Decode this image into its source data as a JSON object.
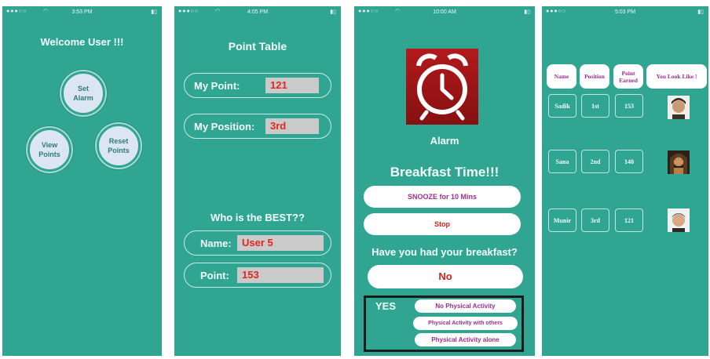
{
  "screens": {
    "welcome": {
      "status_time": "3:53 PM",
      "title": "Welcome User !!!",
      "set_alarm": "Set\nAlarm",
      "view_points": "View\nPoints",
      "reset_points": "Reset\nPoints"
    },
    "point_table": {
      "status_time": "4:05 PM",
      "title": "Point Table",
      "my_point_label": "My Point:",
      "my_point_value": "121",
      "my_position_label": "My Position:",
      "my_position_value": "3rd",
      "best_heading": "Who is the BEST??",
      "name_label": "Name:",
      "name_value": "User 5",
      "point_label": "Point:",
      "point_value": "153"
    },
    "alarm": {
      "status_time": "10:00 AM",
      "alarm_label": "Alarm",
      "breakfast_title": "Breakfast Time!!!",
      "snooze_label": "SNOOZE for 10 Mins",
      "stop_label": "Stop",
      "question": "Have you had your breakfast?",
      "no_label": "No",
      "yes_label": "YES",
      "options": [
        "No Physical Activity",
        "Physical Activity with others",
        "Physical Activity alone"
      ]
    },
    "leaderboard": {
      "status_time": "5:03 PM",
      "headers": [
        "Name",
        "Position",
        "Point\nEarned",
        "You Look Like !"
      ],
      "rows": [
        {
          "name": "Sadik",
          "position": "1st",
          "points": "153"
        },
        {
          "name": "Sana",
          "position": "2nd",
          "points": "140"
        },
        {
          "name": "Munir",
          "position": "3rd",
          "points": "121"
        }
      ]
    }
  },
  "colors": {
    "screen_bg": "#2fa592",
    "value_text": "#e3261d",
    "button_text": "#9b2e8c",
    "alarm_icon_bg": "#9a1214"
  },
  "icons": [
    "alarm-clock-icon",
    "wifi-icon",
    "battery-icon",
    "avatar-icon"
  ]
}
